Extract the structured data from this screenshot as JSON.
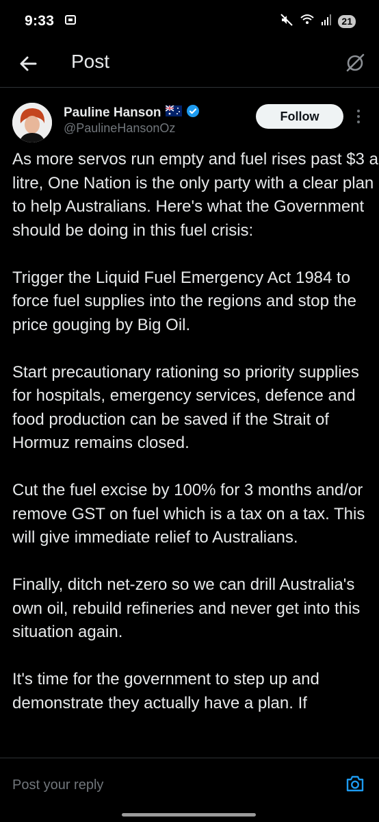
{
  "status_bar": {
    "time": "9:33",
    "battery_level": "21",
    "icons": [
      "screenshot-icon",
      "mute-icon",
      "wifi-icon",
      "signal-icon",
      "battery-icon"
    ]
  },
  "header": {
    "title": "Post",
    "back_icon": "back-arrow-icon",
    "grok_icon": "grok-icon"
  },
  "author": {
    "name": "Pauline Hanson",
    "handle": "@PaulineHansonOz",
    "flag_icon": "australia-flag-icon",
    "verified_icon": "verified-badge-icon",
    "follow_label": "Follow"
  },
  "post": {
    "paragraphs": [
      "As more servos run empty and fuel rises past $3 a litre, One Nation is the only party with a clear plan to help Australians. Here's what the Government should be doing in this fuel crisis:",
      "Trigger the Liquid Fuel Emergency Act 1984 to force fuel supplies into the regions and stop the price gouging by Big Oil.",
      "Start precautionary rationing so priority supplies for hospitals, emergency services, defence and food production can be saved if the Strait of Hormuz remains closed.",
      "Cut the fuel excise by 100% for 3 months and/or remove GST on fuel which is a tax on a tax. This will give immediate relief to Australians.",
      "Finally, ditch net-zero so we can drill Australia's own oil, rebuild refineries and never get into this situation again.",
      "It's time for the government to step up and demonstrate they actually have a plan. If"
    ]
  },
  "reply": {
    "placeholder": "Post your reply",
    "camera_icon": "camera-icon"
  },
  "colors": {
    "background": "#000000",
    "text": "#e7e9ea",
    "secondary_text": "#71767b",
    "accent": "#1d9bf0",
    "divider": "#2f3336",
    "follow_bg": "#eff3f4"
  }
}
